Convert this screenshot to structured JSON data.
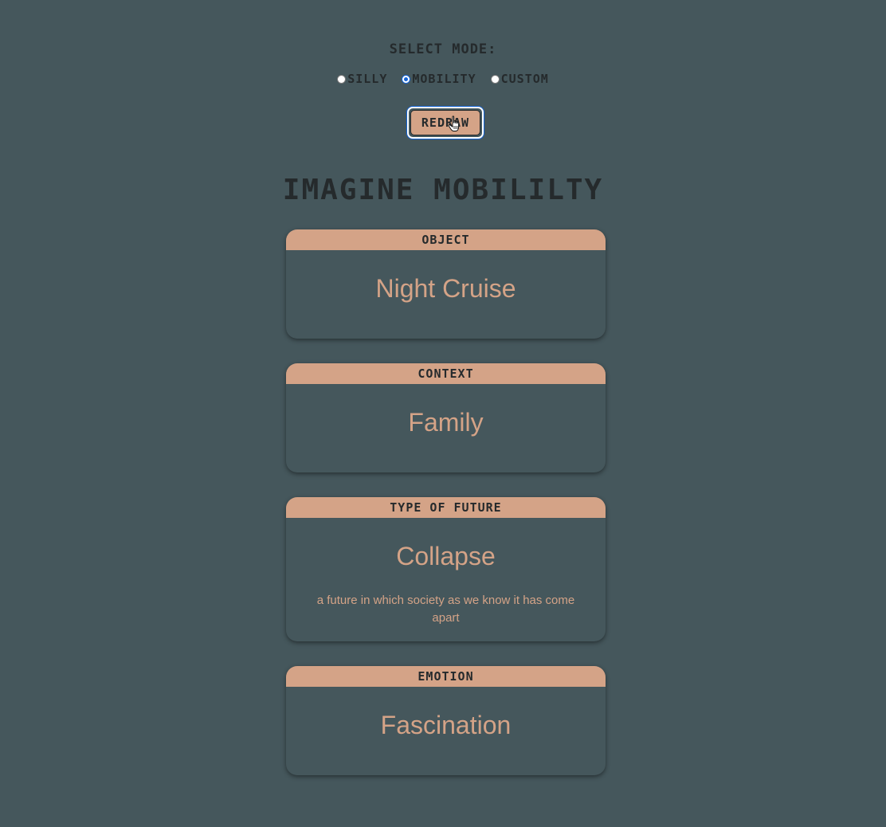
{
  "mode_selector": {
    "label": "SELECT MODE:",
    "options": [
      {
        "label": "SILLY",
        "checked": false
      },
      {
        "label": "MOBILITY",
        "checked": true
      },
      {
        "label": "CUSTOM",
        "checked": false
      }
    ],
    "redraw_label": "REDRAW"
  },
  "title": "IMAGINE MOBILILTY",
  "cards": [
    {
      "header": "OBJECT",
      "value": "Night Cruise",
      "description": ""
    },
    {
      "header": "CONTEXT",
      "value": "Family",
      "description": ""
    },
    {
      "header": "TYPE OF FUTURE",
      "value": "Collapse",
      "description": "a future in which society as we know it has come apart"
    },
    {
      "header": "EMOTION",
      "value": "Fascination",
      "description": ""
    }
  ],
  "colors": {
    "background": "#45575c",
    "accent": "#d4a387",
    "text_dark": "#252a2c",
    "radio_selected": "#1565d8"
  }
}
